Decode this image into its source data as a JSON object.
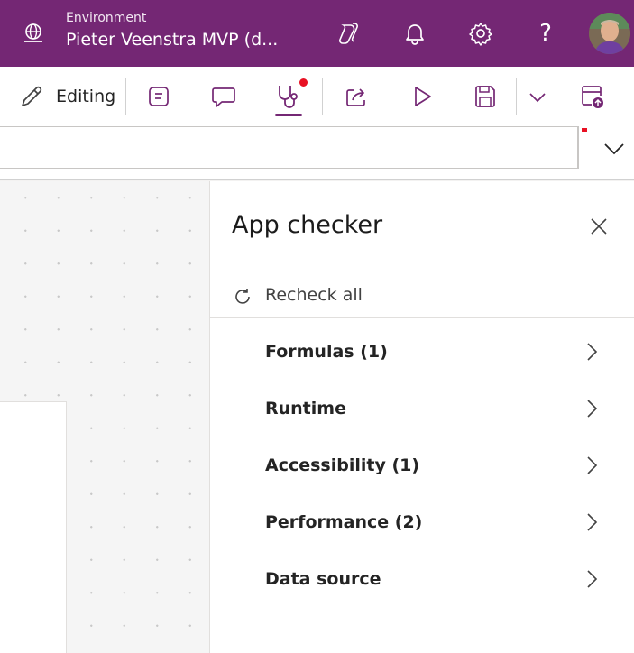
{
  "header": {
    "environment_label": "Environment",
    "environment_name": "Pieter Veenstra MVP (d...",
    "icons": [
      "globe-icon",
      "copilot-icon",
      "bell-icon",
      "gear-icon",
      "help-icon",
      "avatar"
    ],
    "help_glyph": "?",
    "brand_color": "#742774"
  },
  "commandbar": {
    "editing_label": "Editing",
    "icons": [
      "pencil-icon",
      "notes-icon",
      "comment-icon",
      "stethoscope-icon",
      "share-icon",
      "play-icon",
      "save-icon",
      "chevron-down-icon",
      "publish-icon"
    ],
    "active": "stethoscope-icon",
    "alert_color": "#e81123"
  },
  "formula_bar": {
    "value": ""
  },
  "app_checker": {
    "title": "App checker",
    "recheck_label": "Recheck all",
    "categories": [
      {
        "label": "Formulas (1)"
      },
      {
        "label": "Runtime"
      },
      {
        "label": "Accessibility (1)"
      },
      {
        "label": "Performance (2)"
      },
      {
        "label": "Data source"
      }
    ]
  }
}
